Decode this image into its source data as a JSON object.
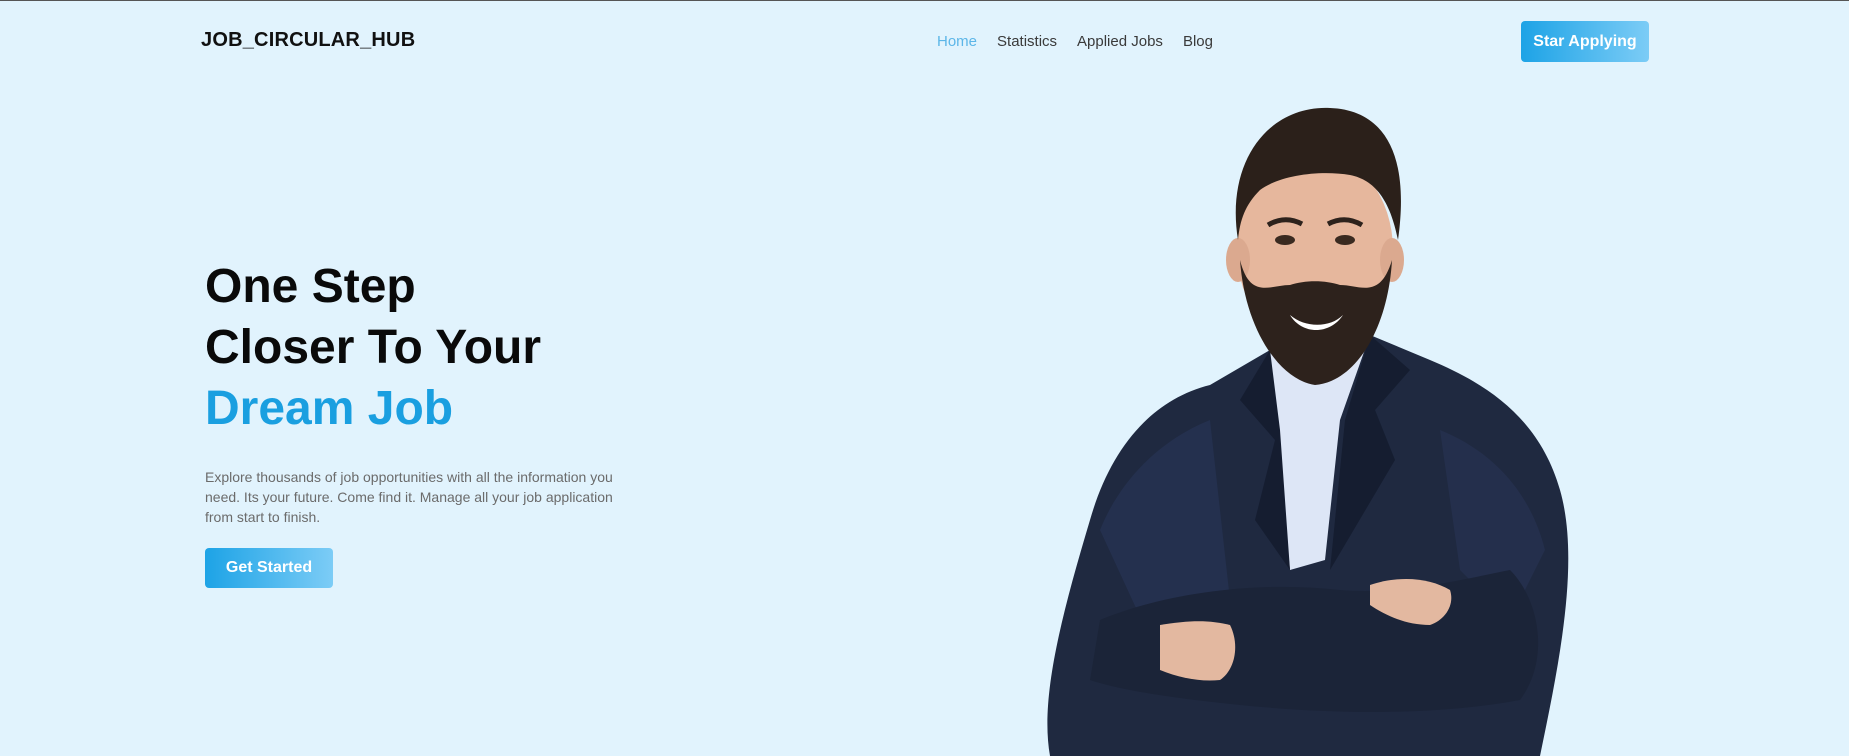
{
  "nav": {
    "logo": "JOB_CIRCULAR_HUB",
    "links": [
      {
        "label": "Home",
        "active": true
      },
      {
        "label": "Statistics",
        "active": false
      },
      {
        "label": "Applied Jobs",
        "active": false
      },
      {
        "label": "Blog",
        "active": false
      }
    ],
    "cta_label": "Star Applying"
  },
  "hero": {
    "title_line1": "One Step",
    "title_line2": "Closer To Your",
    "title_accent": "Dream Job",
    "description": "Explore thousands of job opportunities with all the information you need. Its your future. Come find it. Manage all your job application from start to finish.",
    "button_label": "Get Started"
  },
  "colors": {
    "background": "#e1f3fd",
    "accent": "#1a9fe0",
    "active_link": "#5cb6e8",
    "button_gradient_start": "#1da3e6",
    "button_gradient_end": "#7cccf6"
  }
}
